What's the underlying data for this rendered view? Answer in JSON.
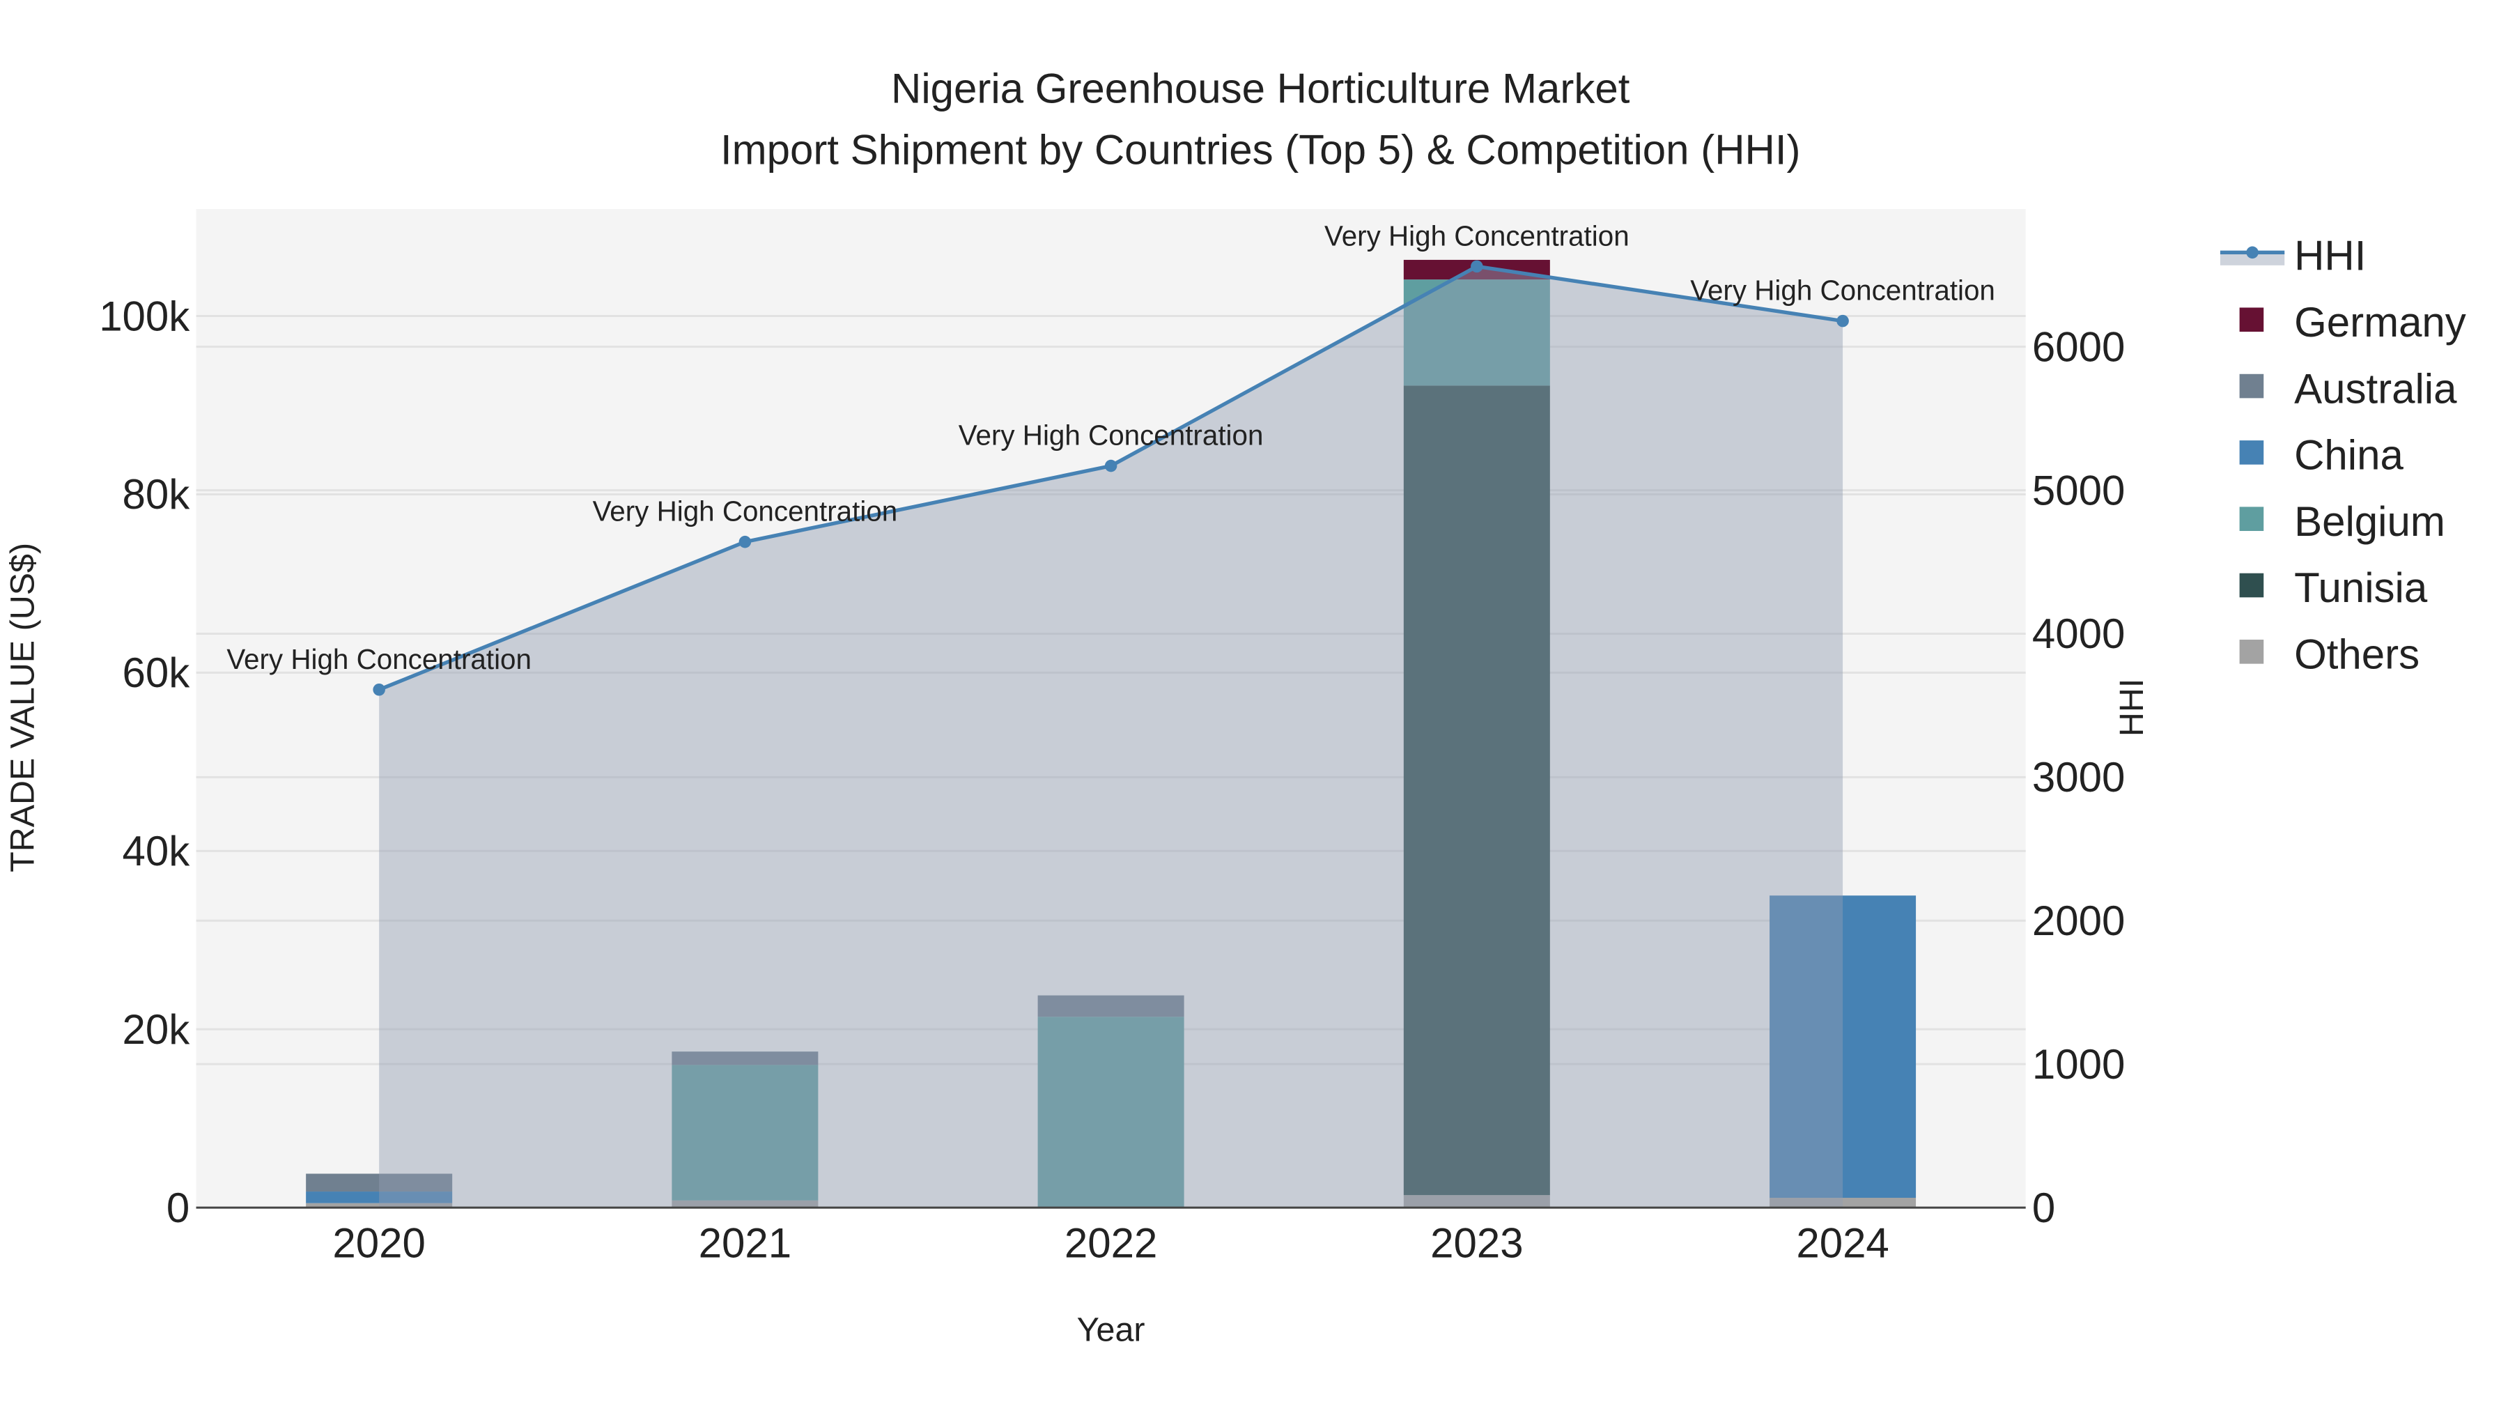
{
  "chart_data": {
    "type": "bar",
    "title": "Nigeria Greenhouse Horticulture Market",
    "subtitle": "Import Shipment by Countries (Top 5) & Competition (HHI)",
    "xlabel": "Year",
    "ylabel": "TRADE VALUE (US$)",
    "y2label": "HHI",
    "categories": [
      "2020",
      "2021",
      "2022",
      "2023",
      "2024"
    ],
    "ylim": [
      0,
      112000
    ],
    "y2lim": [
      0,
      6960
    ],
    "yticks": [
      0,
      20000,
      40000,
      60000,
      80000,
      100000
    ],
    "ytick_labels": [
      "0",
      "20k",
      "40k",
      "60k",
      "80k",
      "100k"
    ],
    "y2ticks": [
      0,
      1000,
      2000,
      3000,
      4000,
      5000,
      6000
    ],
    "y2tick_labels": [
      "0",
      "1000",
      "2000",
      "3000",
      "4000",
      "5000",
      "6000"
    ],
    "grid": true,
    "legend_position": "right",
    "series": [
      {
        "name": "Others",
        "color": "#a3a3a3",
        "values": [
          500,
          800,
          0,
          1400,
          1100
        ]
      },
      {
        "name": "Tunisia",
        "color": "#2f4f4f",
        "values": [
          0,
          0,
          0,
          90800,
          0
        ]
      },
      {
        "name": "Belgium",
        "color": "#5f9ea0",
        "values": [
          0,
          15200,
          21400,
          11900,
          0
        ]
      },
      {
        "name": "China",
        "color": "#4682b4",
        "values": [
          1300,
          0,
          0,
          0,
          33900
        ]
      },
      {
        "name": "Australia",
        "color": "#708090",
        "values": [
          2000,
          1500,
          2400,
          0,
          0
        ]
      },
      {
        "name": "Germany",
        "color": "#661133",
        "values": [
          0,
          0,
          0,
          2200,
          0
        ]
      }
    ],
    "legend_order": [
      "HHI",
      "Germany",
      "Australia",
      "China",
      "Belgium",
      "Tunisia",
      "Others"
    ],
    "hhi": {
      "name": "HHI",
      "color": "#4682b4",
      "values": [
        3610,
        4640,
        5170,
        6560,
        6180
      ],
      "annotations": [
        "Very High Concentration",
        "Very High Concentration",
        "Very High Concentration",
        "Very High Concentration",
        "Very High Concentration"
      ]
    }
  }
}
